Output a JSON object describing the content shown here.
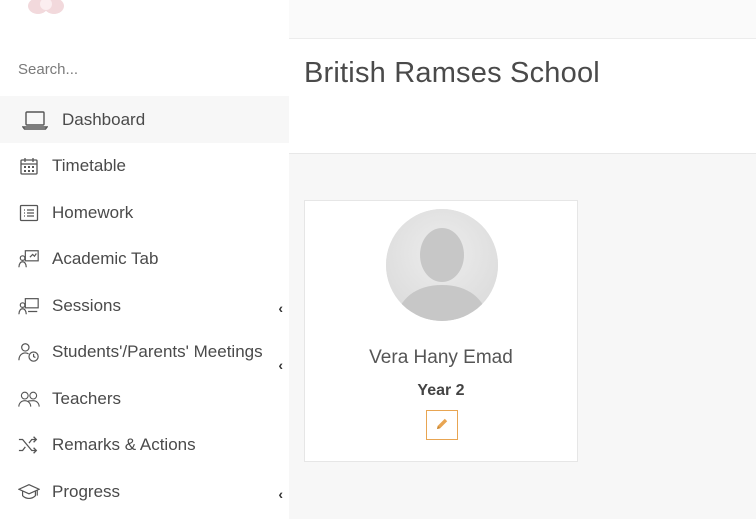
{
  "search": {
    "placeholder": "Search..."
  },
  "sidebar": {
    "items": [
      {
        "label": "Dashboard",
        "icon": "laptop-icon",
        "active": true
      },
      {
        "label": "Timetable",
        "icon": "calendar-icon"
      },
      {
        "label": "Homework",
        "icon": "list-icon"
      },
      {
        "label": "Academic Tab",
        "icon": "presentation-icon"
      },
      {
        "label": "Sessions",
        "icon": "classroom-icon",
        "chevron": "‹"
      },
      {
        "label": "Students'/Parents' Meetings",
        "icon": "user-clock-icon",
        "chevron": "‹"
      },
      {
        "label": "Teachers",
        "icon": "users-icon"
      },
      {
        "label": "Remarks & Actions",
        "icon": "shuffle-icon"
      },
      {
        "label": "Progress",
        "icon": "graduation-cap-icon",
        "chevron": "‹"
      }
    ]
  },
  "header": {
    "title": "British Ramses School"
  },
  "student": {
    "name": "Vera Hany Emad",
    "year": "Year 2"
  },
  "colors": {
    "accent_orange": "#e8a552",
    "active_bg": "#f7f7f7",
    "content_bg": "#f7f7f7"
  }
}
